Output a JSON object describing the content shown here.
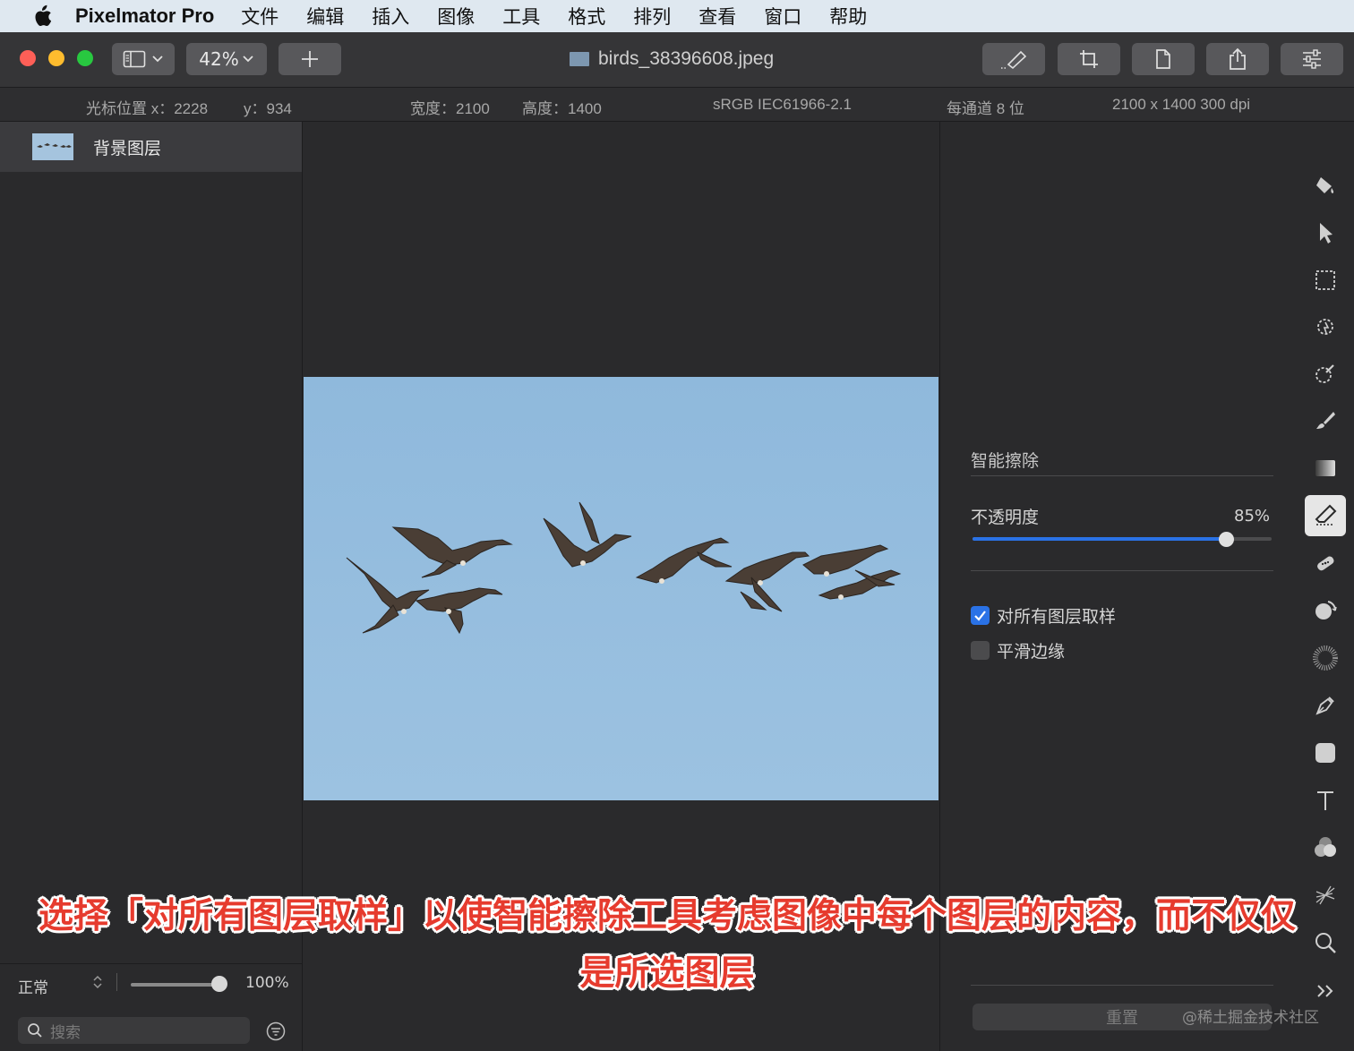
{
  "menubar": {
    "app_name": "Pixelmator Pro",
    "items": [
      "文件",
      "编辑",
      "插入",
      "图像",
      "工具",
      "格式",
      "排列",
      "查看",
      "窗口",
      "帮助"
    ]
  },
  "toolbar": {
    "zoom": "42%",
    "document_title": "birds_38396608.jpeg"
  },
  "infobar": {
    "cursor_x": "光标位置 x：2228",
    "cursor_y": "y：934",
    "width": "宽度：2100",
    "height": "高度：1400",
    "color_profile": "sRGB IEC61966-2.1",
    "bit_depth": "每通道 8 位",
    "dimensions_dpi": "2100 x 1400 300 dpi"
  },
  "layers": {
    "items": [
      {
        "name": "背景图层"
      }
    ],
    "blend_mode": "正常",
    "opacity": "100%",
    "search_placeholder": "搜索"
  },
  "tool_options": {
    "title": "智能擦除",
    "opacity_label": "不透明度",
    "opacity_value": "85%",
    "opacity_fraction": 0.85,
    "sample_all_layers_label": "对所有图层取样",
    "sample_all_layers_checked": true,
    "smooth_edges_label": "平滑边缘",
    "smooth_edges_checked": false,
    "reset_label": "重置"
  },
  "tools": [
    "paint-bucket-icon",
    "arrange-icon",
    "rect-select-icon",
    "magic-select-icon",
    "color-adjust-icon",
    "paint-brush-icon",
    "gradient-icon",
    "smart-erase-icon",
    "repair-icon",
    "retouch-icon",
    "distort-icon",
    "pen-icon",
    "shape-icon",
    "type-icon",
    "color-blend-icon",
    "effects-icon",
    "zoom-icon",
    "more-icon"
  ],
  "active_tool": "smart-erase-icon",
  "subtitle": {
    "line1": "选择「对所有图层取样」以使智能擦除工具考虑图像中每个图层的内容，而不仅仅",
    "line2": "是所选图层"
  },
  "watermark": "@稀土掘金技术社区",
  "colors": {
    "accent": "#2a72e6",
    "subtitle_red": "#e63b2e",
    "sky": "#94bddf"
  }
}
